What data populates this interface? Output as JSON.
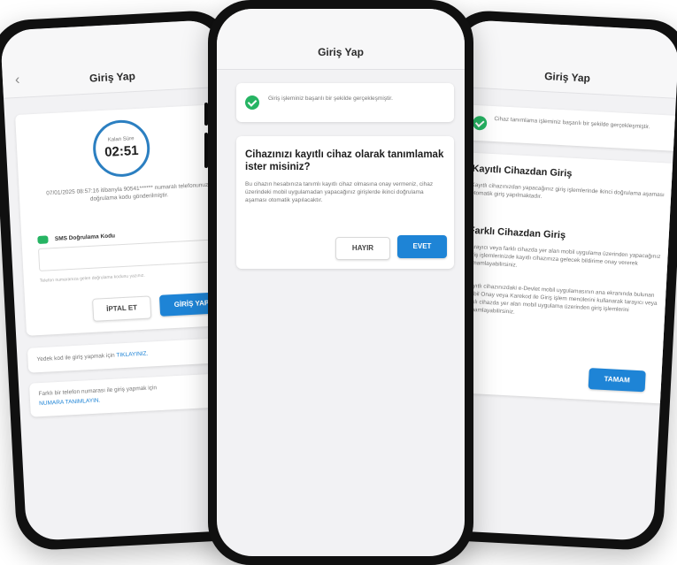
{
  "colors": {
    "primary": "#1e84d6",
    "success": "#26b463",
    "frame": "#101010"
  },
  "left": {
    "title": "Giriş Yap",
    "back_icon": "chevron-left-icon",
    "timer_label": "Kalan Süre",
    "timer_value": "02:51",
    "info_text": "07/01/2025 08:57:16 itibarıyla 90541****** numaralı telefonunuza doğrulama kodu gönderilmiştir.",
    "sms_label": "SMS Doğrulama Kodu",
    "sms_icon": "message-icon",
    "input_placeholder": "",
    "input_hint": "Telefon numaranıza gelen doğrulama kodunu yazınız.",
    "cancel_label": "İPTAL ET",
    "login_label": "GİRİŞ YAP",
    "backup_text": "Yedek kod ile giriş yapmak için",
    "backup_link": "TIKLAYINIZ.",
    "other_text": "Farklı bir telefon numarası ile giriş yapmak için",
    "other_link": "NUMARA TANIMLAYIN."
  },
  "center": {
    "title": "Giriş Yap",
    "success_text": "Giriş işleminiz başarılı bir şekilde gerçekleşmiştir.",
    "success_icon": "check-circle-icon",
    "question": "Cihazınızı kayıtlı cihaz olarak tanımlamak ister misiniz?",
    "description": "Bu cihazın hesabınıza tanımlı kayıtlı cihaz olmasına onay vermeniz, cihaz üzerindeki mobil uygulamadan yapacağınız girişlerde ikinci doğrulama aşaması otomatik yapılacaktır.",
    "no_label": "HAYIR",
    "yes_label": "EVET"
  },
  "right": {
    "title": "Giriş Yap",
    "success_text": "Cihaz tanımlama işleminiz başarılı bir şekilde gerçekleşmiştir.",
    "success_icon": "check-circle-icon",
    "heading1": "Kayıtlı Cihazdan Giriş",
    "text1": "Kayıtlı cihazınızdan yapacağınız giriş işlemlerinde ikinci doğrulama aşaması otomatik giriş yapılmaktadır.",
    "heading2": "Farklı Cihazdan Giriş",
    "text2a": "Tarayıcı veya farklı cihazda yer alan mobil uygulama üzerinden yapacağınız giriş işlemlerinizde kayıtlı cihazınıza gelecek bildirime onay vererek tamamlayabilirsiniz.",
    "text2b": "Kayıtlı cihazınızdaki e-Devlet mobil uygulamasının ana ekranında bulunan Mobil Onay veya Karekod ile Giriş işlem menülerini kullanarak tarayıcı veya farklı cihazda yer alan mobil uygulama üzerinden giriş işlemlerini tamamlayabilirsiniz.",
    "ok_label": "TAMAM"
  }
}
